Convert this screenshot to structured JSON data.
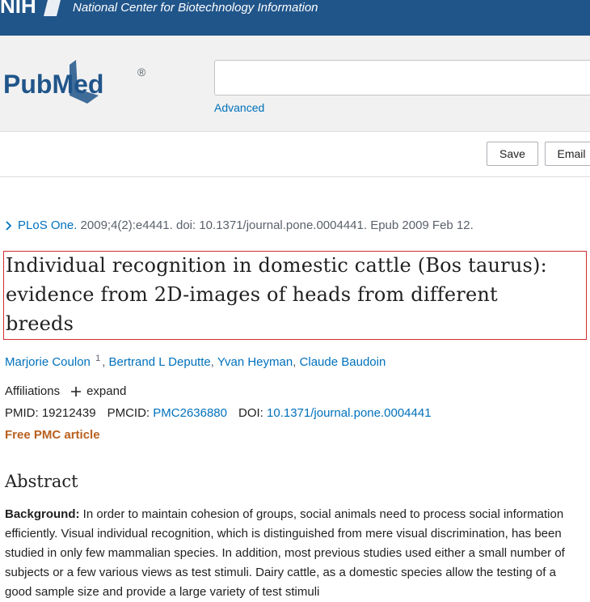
{
  "header": {
    "ncbi_name": "National Center for Biotechnology Information",
    "logo_text": "NIH"
  },
  "search": {
    "logo_text": "PubMed",
    "logo_mark": "®",
    "query": "",
    "advanced_label": "Advanced"
  },
  "actions": {
    "save_label": "Save",
    "email_label": "Email"
  },
  "article": {
    "journal": "PLoS One.",
    "citation_rest": " 2009;4(2):e4441. doi: 10.1371/journal.pone.0004441. Epub 2009 Feb 12.",
    "title": "Individual recognition in domestic cattle (Bos taurus): evidence from 2D-images of heads from different breeds",
    "authors": [
      {
        "name": "Marjorie Coulon",
        "affil": "1"
      },
      {
        "name": "Bertrand L Deputte"
      },
      {
        "name": "Yvan Heyman"
      },
      {
        "name": "Claude Baudoin"
      }
    ],
    "affiliations_label": "Affiliations",
    "expand_label": "expand",
    "pmid_label": "PMID:",
    "pmid": "19212439",
    "pmcid_label": "PMCID:",
    "pmcid": "PMC2636880",
    "doi_label": "DOI:",
    "doi": "10.1371/journal.pone.0004441",
    "free_pmc": "Free PMC article"
  },
  "abstract": {
    "heading": "Abstract",
    "background_label": "Background:",
    "background_text": " In order to maintain cohesion of groups, social animals need to process social information efficiently. Visual individual recognition, which is distinguished from mere visual discrimination, has been studied in only few mammalian species. In addition, most previous studies used either a small number of subjects or a few various views as test stimuli. Dairy cattle, as a domestic species allow the testing of a good sample size and provide a large variety of test stimuli"
  },
  "colors": {
    "ncbi_blue": "#20558a",
    "link_blue": "#0071bc",
    "free_pmc_orange": "#b9601f",
    "highlight_red": "#d02c2f"
  }
}
